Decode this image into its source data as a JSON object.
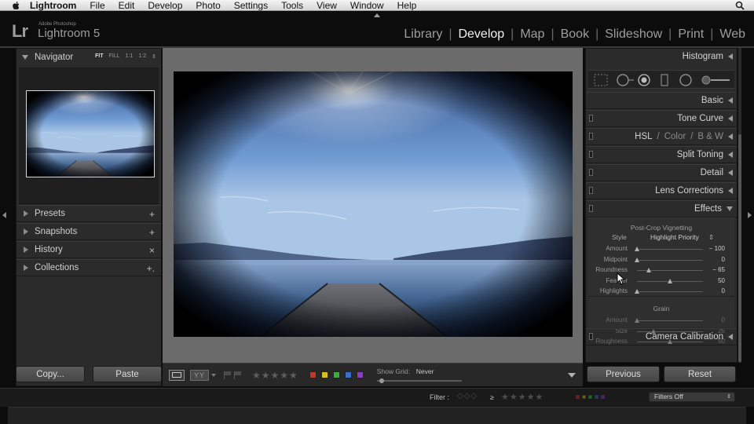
{
  "menubar": {
    "app": "Lightroom",
    "items": [
      "File",
      "Edit",
      "Develop",
      "Photo",
      "Settings",
      "Tools",
      "View",
      "Window",
      "Help"
    ]
  },
  "identity": {
    "lr": "Lr",
    "vendor": "Adobe Photoshop",
    "product": "Lightroom 5"
  },
  "modules": {
    "library": "Library",
    "develop": "Develop",
    "map": "Map",
    "book": "Book",
    "slideshow": "Slideshow",
    "print": "Print",
    "web": "Web",
    "active": "Develop"
  },
  "left_panel": {
    "navigator": {
      "title": "Navigator",
      "fit": "FIT",
      "fill": "FILL",
      "one_to_one": "1:1",
      "ratio": "1:2"
    },
    "presets": {
      "label": "Presets",
      "action": "+"
    },
    "snapshots": {
      "label": "Snapshots",
      "action": "+"
    },
    "history": {
      "label": "History",
      "action": "×"
    },
    "collections": {
      "label": "Collections",
      "action": "+."
    },
    "copy_button": "Copy...",
    "paste_button": "Paste"
  },
  "toolbar": {
    "yy": "YY",
    "stars": "★★★★★",
    "color_labels": [
      "#c0392b",
      "#d4c12a",
      "#3fa83f",
      "#3a6fc4",
      "#8a3fc4"
    ],
    "show_grid_label": "Show Grid:",
    "show_grid_value": "Never"
  },
  "right_panel": {
    "histogram": "Histogram",
    "basic": "Basic",
    "tone_curve": "Tone Curve",
    "hsl": {
      "hsl": "HSL",
      "sep": "/",
      "color": "Color",
      "bw": "B & W"
    },
    "split_toning": "Split Toning",
    "detail": "Detail",
    "lens_corrections": "Lens Corrections",
    "effects": {
      "title": "Effects",
      "vignetting": {
        "title": "Post-Crop Vignetting",
        "style_label": "Style",
        "style_value": "Highlight Priority",
        "sliders": [
          {
            "label": "Amount",
            "value": "− 100",
            "position": 0.0
          },
          {
            "label": "Midpoint",
            "value": "0",
            "position": 0.0
          },
          {
            "label": "Roundness",
            "value": "− 65",
            "position": 0.18
          },
          {
            "label": "Feather",
            "value": "50",
            "position": 0.5
          },
          {
            "label": "Highlights",
            "value": "0",
            "position": 0.0
          }
        ]
      },
      "grain": {
        "title": "Grain",
        "sliders": [
          {
            "label": "Amount",
            "value": "0",
            "position": 0.0
          },
          {
            "label": "Size",
            "value": "25",
            "position": 0.25
          },
          {
            "label": "Roughness",
            "value": "50",
            "position": 0.5
          }
        ]
      }
    },
    "camera_calibration": "Camera Calibration",
    "previous_button": "Previous",
    "reset_button": "Reset"
  },
  "filmstrip": {
    "filter_label": "Filter :",
    "filter_ge": "≥",
    "stars": "★★★★★",
    "filters_value": "Filters Off"
  }
}
